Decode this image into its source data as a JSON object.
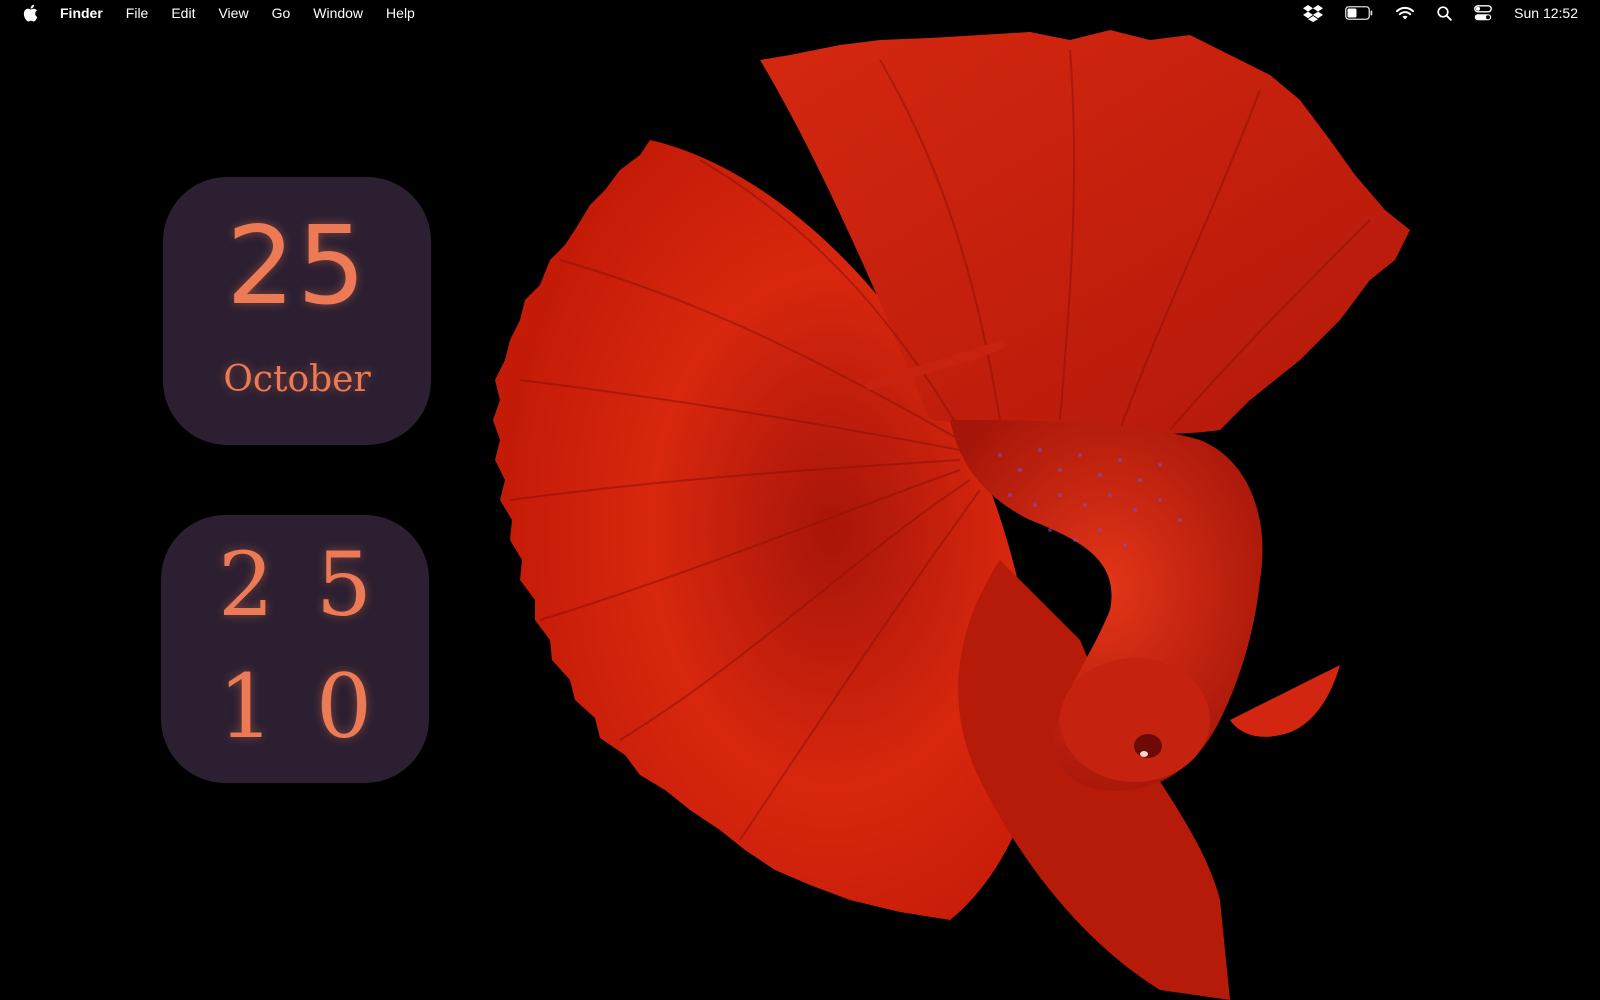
{
  "menubar": {
    "apple_icon": "apple-logo-icon",
    "items": [
      "Finder",
      "File",
      "Edit",
      "View",
      "Go",
      "Window",
      "Help"
    ],
    "status_icons": [
      "dropbox-icon",
      "battery-icon",
      "wifi-icon",
      "search-icon",
      "control-center-icon"
    ],
    "clock": "Sun 12:52"
  },
  "wallpaper": {
    "subject": "red-betta-fish",
    "background_color": "#000000",
    "fish_color": "#c91d0b"
  },
  "widgets": {
    "date": {
      "day": "25",
      "month": "October"
    },
    "grid": {
      "digits": [
        "2",
        "5",
        "1",
        "0"
      ]
    },
    "background_color": "#2b1f31",
    "text_color": "#ec7a54"
  }
}
